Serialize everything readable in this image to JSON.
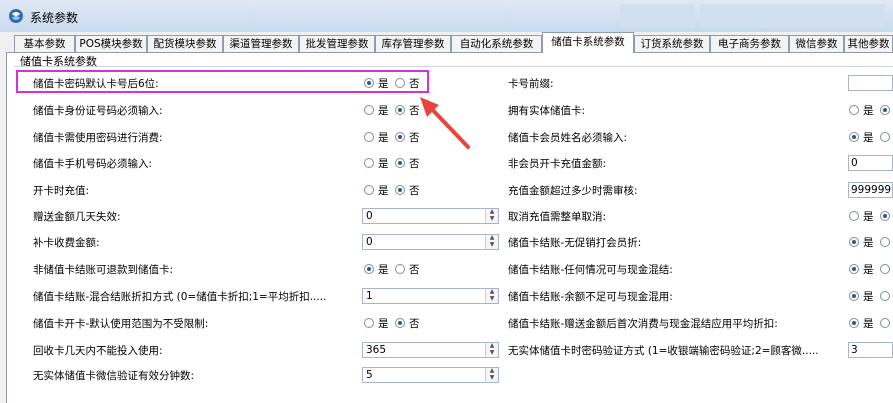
{
  "window": {
    "title": "系统参数"
  },
  "tabs": [
    {
      "label": "基本参数"
    },
    {
      "label": "POS模块参数"
    },
    {
      "label": "配货模块参数"
    },
    {
      "label": "渠道管理参数"
    },
    {
      "label": "批发管理参数"
    },
    {
      "label": "库存管理参数"
    },
    {
      "label": "自动化系统参数"
    },
    {
      "label": "储值卡系统参数"
    },
    {
      "label": "订货系统参数"
    },
    {
      "label": "电子商务参数"
    },
    {
      "label": "微信参数"
    },
    {
      "label": "其他参数"
    }
  ],
  "group": {
    "title": "储值卡系统参数"
  },
  "radio_text": {
    "yes": "是",
    "no": "否"
  },
  "left": [
    {
      "label": "储值卡密码默认卡号后6位:",
      "type": "radio",
      "value": "是"
    },
    {
      "label": "储值卡身份证号码必须输入:",
      "type": "radio",
      "value": "否"
    },
    {
      "label": "储值卡需使用密码进行消费:",
      "type": "radio",
      "value": "否"
    },
    {
      "label": "储值卡手机号码必须输入:",
      "type": "radio",
      "value": "否"
    },
    {
      "label": "开卡时充值:",
      "type": "radio",
      "value": "否"
    },
    {
      "label": "赠送金额几天失效:",
      "type": "spin",
      "value": "0"
    },
    {
      "label": "补卡收费金额:",
      "type": "spin",
      "value": "0"
    },
    {
      "label": "非储值卡结账可退款到储值卡:",
      "type": "radio",
      "value": "是"
    },
    {
      "label": "储值卡结账-混合结账折扣方式 (0=储值卡折扣;1=平均折扣.....",
      "type": "spin",
      "value": "1"
    },
    {
      "label": "储值卡开卡-默认使用范围为不受限制:",
      "type": "radio",
      "value": "否"
    },
    {
      "label": "回收卡几天内不能投入使用:",
      "type": "spin",
      "value": "365"
    },
    {
      "label": "无实体储值卡微信验证有效分钟数:",
      "type": "spin",
      "value": "5"
    }
  ],
  "right": [
    {
      "label": "卡号前缀:",
      "type": "text",
      "value": ""
    },
    {
      "label": "拥有实体储值卡:",
      "type": "radio",
      "value": "否"
    },
    {
      "label": "储值卡会员姓名必须输入:",
      "type": "radio",
      "value": "是"
    },
    {
      "label": "非会员开卡充值金额:",
      "type": "text",
      "value": "0"
    },
    {
      "label": "充值金额超过多少时需审核:",
      "type": "text",
      "value": "99999999"
    },
    {
      "label": "取消充值需整单取消:",
      "type": "radio",
      "value": "否"
    },
    {
      "label": "储值卡结账-无促销打会员折:",
      "type": "radio",
      "value": "是"
    },
    {
      "label": "储值卡结账-任何情况可与现金混结:",
      "type": "radio",
      "value": "是"
    },
    {
      "label": "储值卡结账-余额不足可与现金混用:",
      "type": "radio",
      "value": "是"
    },
    {
      "label": "储值卡结账-赠送金额后首次消费与现金混结应用平均折扣:",
      "type": "radio",
      "value": "是"
    },
    {
      "label": "无实体储值卡时密码验证方式 (1=收银端输密码验证;2=顾客微.....",
      "type": "text",
      "value": "3"
    }
  ],
  "colors": {
    "highlight": "#d630d6",
    "arrow": "#e8453c"
  }
}
